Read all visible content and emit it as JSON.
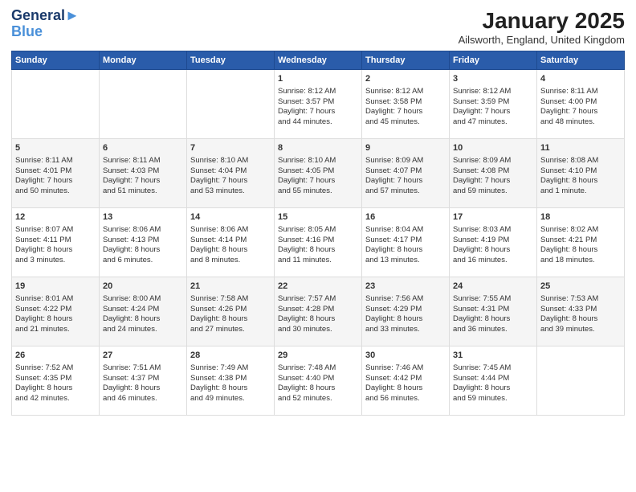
{
  "header": {
    "logo_line1": "General",
    "logo_line2": "Blue",
    "title": "January 2025",
    "subtitle": "Ailsworth, England, United Kingdom"
  },
  "weekdays": [
    "Sunday",
    "Monday",
    "Tuesday",
    "Wednesday",
    "Thursday",
    "Friday",
    "Saturday"
  ],
  "weeks": [
    [
      {
        "day": "",
        "content": ""
      },
      {
        "day": "",
        "content": ""
      },
      {
        "day": "",
        "content": ""
      },
      {
        "day": "1",
        "content": "Sunrise: 8:12 AM\nSunset: 3:57 PM\nDaylight: 7 hours\nand 44 minutes."
      },
      {
        "day": "2",
        "content": "Sunrise: 8:12 AM\nSunset: 3:58 PM\nDaylight: 7 hours\nand 45 minutes."
      },
      {
        "day": "3",
        "content": "Sunrise: 8:12 AM\nSunset: 3:59 PM\nDaylight: 7 hours\nand 47 minutes."
      },
      {
        "day": "4",
        "content": "Sunrise: 8:11 AM\nSunset: 4:00 PM\nDaylight: 7 hours\nand 48 minutes."
      }
    ],
    [
      {
        "day": "5",
        "content": "Sunrise: 8:11 AM\nSunset: 4:01 PM\nDaylight: 7 hours\nand 50 minutes."
      },
      {
        "day": "6",
        "content": "Sunrise: 8:11 AM\nSunset: 4:03 PM\nDaylight: 7 hours\nand 51 minutes."
      },
      {
        "day": "7",
        "content": "Sunrise: 8:10 AM\nSunset: 4:04 PM\nDaylight: 7 hours\nand 53 minutes."
      },
      {
        "day": "8",
        "content": "Sunrise: 8:10 AM\nSunset: 4:05 PM\nDaylight: 7 hours\nand 55 minutes."
      },
      {
        "day": "9",
        "content": "Sunrise: 8:09 AM\nSunset: 4:07 PM\nDaylight: 7 hours\nand 57 minutes."
      },
      {
        "day": "10",
        "content": "Sunrise: 8:09 AM\nSunset: 4:08 PM\nDaylight: 7 hours\nand 59 minutes."
      },
      {
        "day": "11",
        "content": "Sunrise: 8:08 AM\nSunset: 4:10 PM\nDaylight: 8 hours\nand 1 minute."
      }
    ],
    [
      {
        "day": "12",
        "content": "Sunrise: 8:07 AM\nSunset: 4:11 PM\nDaylight: 8 hours\nand 3 minutes."
      },
      {
        "day": "13",
        "content": "Sunrise: 8:06 AM\nSunset: 4:13 PM\nDaylight: 8 hours\nand 6 minutes."
      },
      {
        "day": "14",
        "content": "Sunrise: 8:06 AM\nSunset: 4:14 PM\nDaylight: 8 hours\nand 8 minutes."
      },
      {
        "day": "15",
        "content": "Sunrise: 8:05 AM\nSunset: 4:16 PM\nDaylight: 8 hours\nand 11 minutes."
      },
      {
        "day": "16",
        "content": "Sunrise: 8:04 AM\nSunset: 4:17 PM\nDaylight: 8 hours\nand 13 minutes."
      },
      {
        "day": "17",
        "content": "Sunrise: 8:03 AM\nSunset: 4:19 PM\nDaylight: 8 hours\nand 16 minutes."
      },
      {
        "day": "18",
        "content": "Sunrise: 8:02 AM\nSunset: 4:21 PM\nDaylight: 8 hours\nand 18 minutes."
      }
    ],
    [
      {
        "day": "19",
        "content": "Sunrise: 8:01 AM\nSunset: 4:22 PM\nDaylight: 8 hours\nand 21 minutes."
      },
      {
        "day": "20",
        "content": "Sunrise: 8:00 AM\nSunset: 4:24 PM\nDaylight: 8 hours\nand 24 minutes."
      },
      {
        "day": "21",
        "content": "Sunrise: 7:58 AM\nSunset: 4:26 PM\nDaylight: 8 hours\nand 27 minutes."
      },
      {
        "day": "22",
        "content": "Sunrise: 7:57 AM\nSunset: 4:28 PM\nDaylight: 8 hours\nand 30 minutes."
      },
      {
        "day": "23",
        "content": "Sunrise: 7:56 AM\nSunset: 4:29 PM\nDaylight: 8 hours\nand 33 minutes."
      },
      {
        "day": "24",
        "content": "Sunrise: 7:55 AM\nSunset: 4:31 PM\nDaylight: 8 hours\nand 36 minutes."
      },
      {
        "day": "25",
        "content": "Sunrise: 7:53 AM\nSunset: 4:33 PM\nDaylight: 8 hours\nand 39 minutes."
      }
    ],
    [
      {
        "day": "26",
        "content": "Sunrise: 7:52 AM\nSunset: 4:35 PM\nDaylight: 8 hours\nand 42 minutes."
      },
      {
        "day": "27",
        "content": "Sunrise: 7:51 AM\nSunset: 4:37 PM\nDaylight: 8 hours\nand 46 minutes."
      },
      {
        "day": "28",
        "content": "Sunrise: 7:49 AM\nSunset: 4:38 PM\nDaylight: 8 hours\nand 49 minutes."
      },
      {
        "day": "29",
        "content": "Sunrise: 7:48 AM\nSunset: 4:40 PM\nDaylight: 8 hours\nand 52 minutes."
      },
      {
        "day": "30",
        "content": "Sunrise: 7:46 AM\nSunset: 4:42 PM\nDaylight: 8 hours\nand 56 minutes."
      },
      {
        "day": "31",
        "content": "Sunrise: 7:45 AM\nSunset: 4:44 PM\nDaylight: 8 hours\nand 59 minutes."
      },
      {
        "day": "",
        "content": ""
      }
    ]
  ]
}
